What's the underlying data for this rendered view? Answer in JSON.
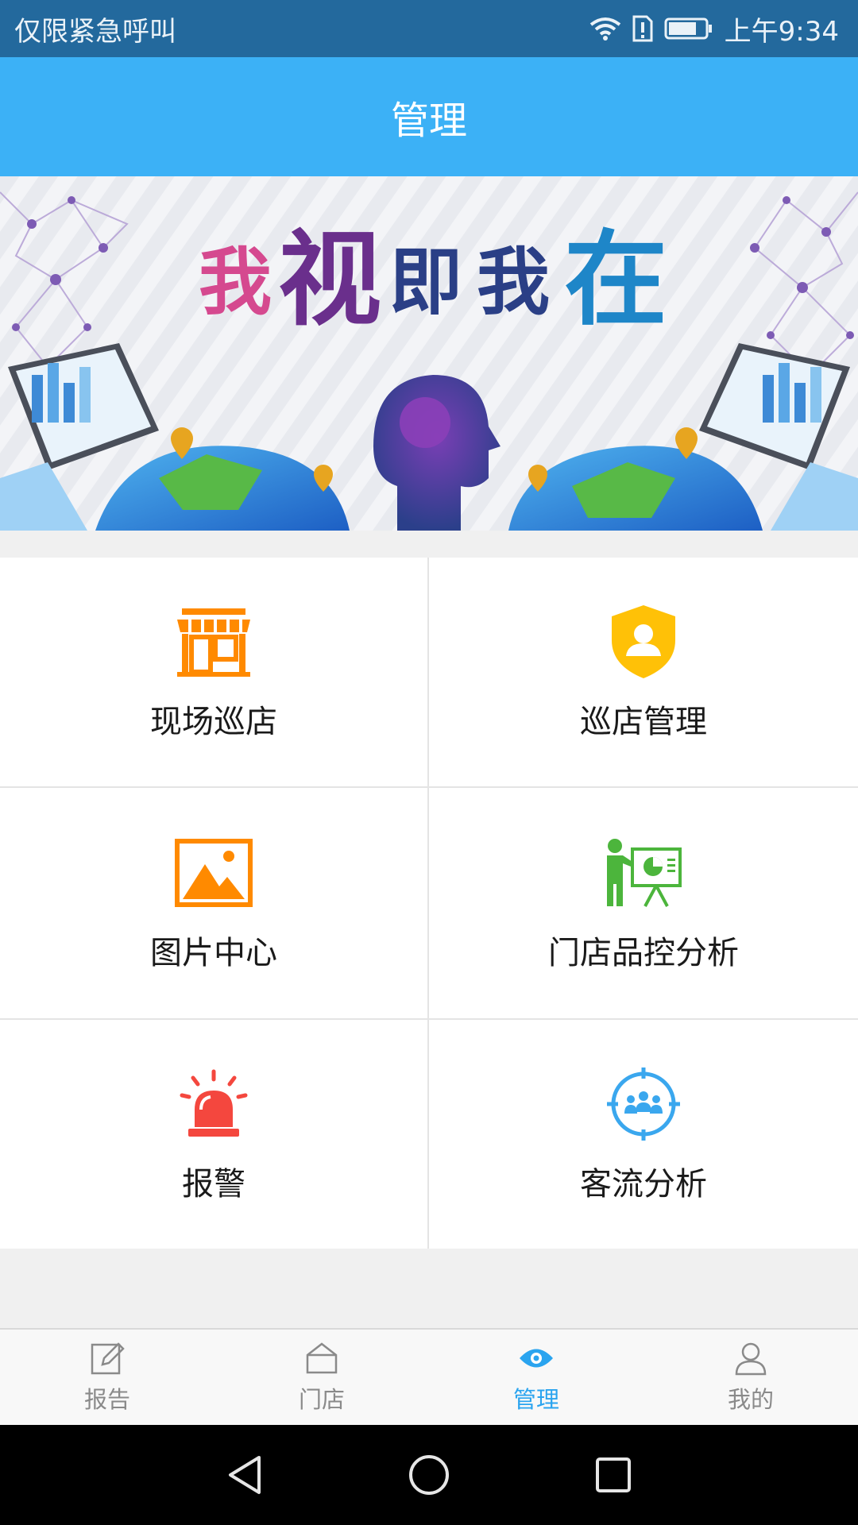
{
  "status_bar": {
    "carrier_text": "仅限紧急呼叫",
    "time": "上午9:34",
    "icons": [
      "wifi-icon",
      "sim-alert-icon",
      "battery-icon"
    ]
  },
  "header": {
    "title": "管理"
  },
  "banner": {
    "slogan_chars": [
      "我",
      "视",
      "即",
      "我",
      "在"
    ],
    "colors": {
      "pink": "#d5498f",
      "purple": "#6a2f8c",
      "navy": "#2a3f86",
      "blue": "#1e86c8"
    }
  },
  "menu": {
    "items": [
      {
        "label": "现场巡店",
        "icon": "storefront-icon",
        "color": "#ff8a00"
      },
      {
        "label": "巡店管理",
        "icon": "shield-user-icon",
        "color": "#ffc107"
      },
      {
        "label": "图片中心",
        "icon": "picture-icon",
        "color": "#ff8a00"
      },
      {
        "label": "门店品控分析",
        "icon": "presentation-icon",
        "color": "#4cb53c"
      },
      {
        "label": "报警",
        "icon": "alarm-light-icon",
        "color": "#f4473e"
      },
      {
        "label": "客流分析",
        "icon": "customer-flow-icon",
        "color": "#3aa7ee"
      }
    ]
  },
  "tabbar": {
    "tabs": [
      {
        "label": "报告",
        "icon": "report-edit-icon",
        "active": false
      },
      {
        "label": "门店",
        "icon": "store-house-icon",
        "active": false
      },
      {
        "label": "管理",
        "icon": "eye-icon",
        "active": true
      },
      {
        "label": "我的",
        "icon": "user-icon",
        "active": false
      }
    ],
    "active_color": "#2aa4ef",
    "inactive_color": "#8a8a8a"
  },
  "system_nav": {
    "buttons": [
      "back-icon",
      "home-icon",
      "recents-icon"
    ]
  }
}
